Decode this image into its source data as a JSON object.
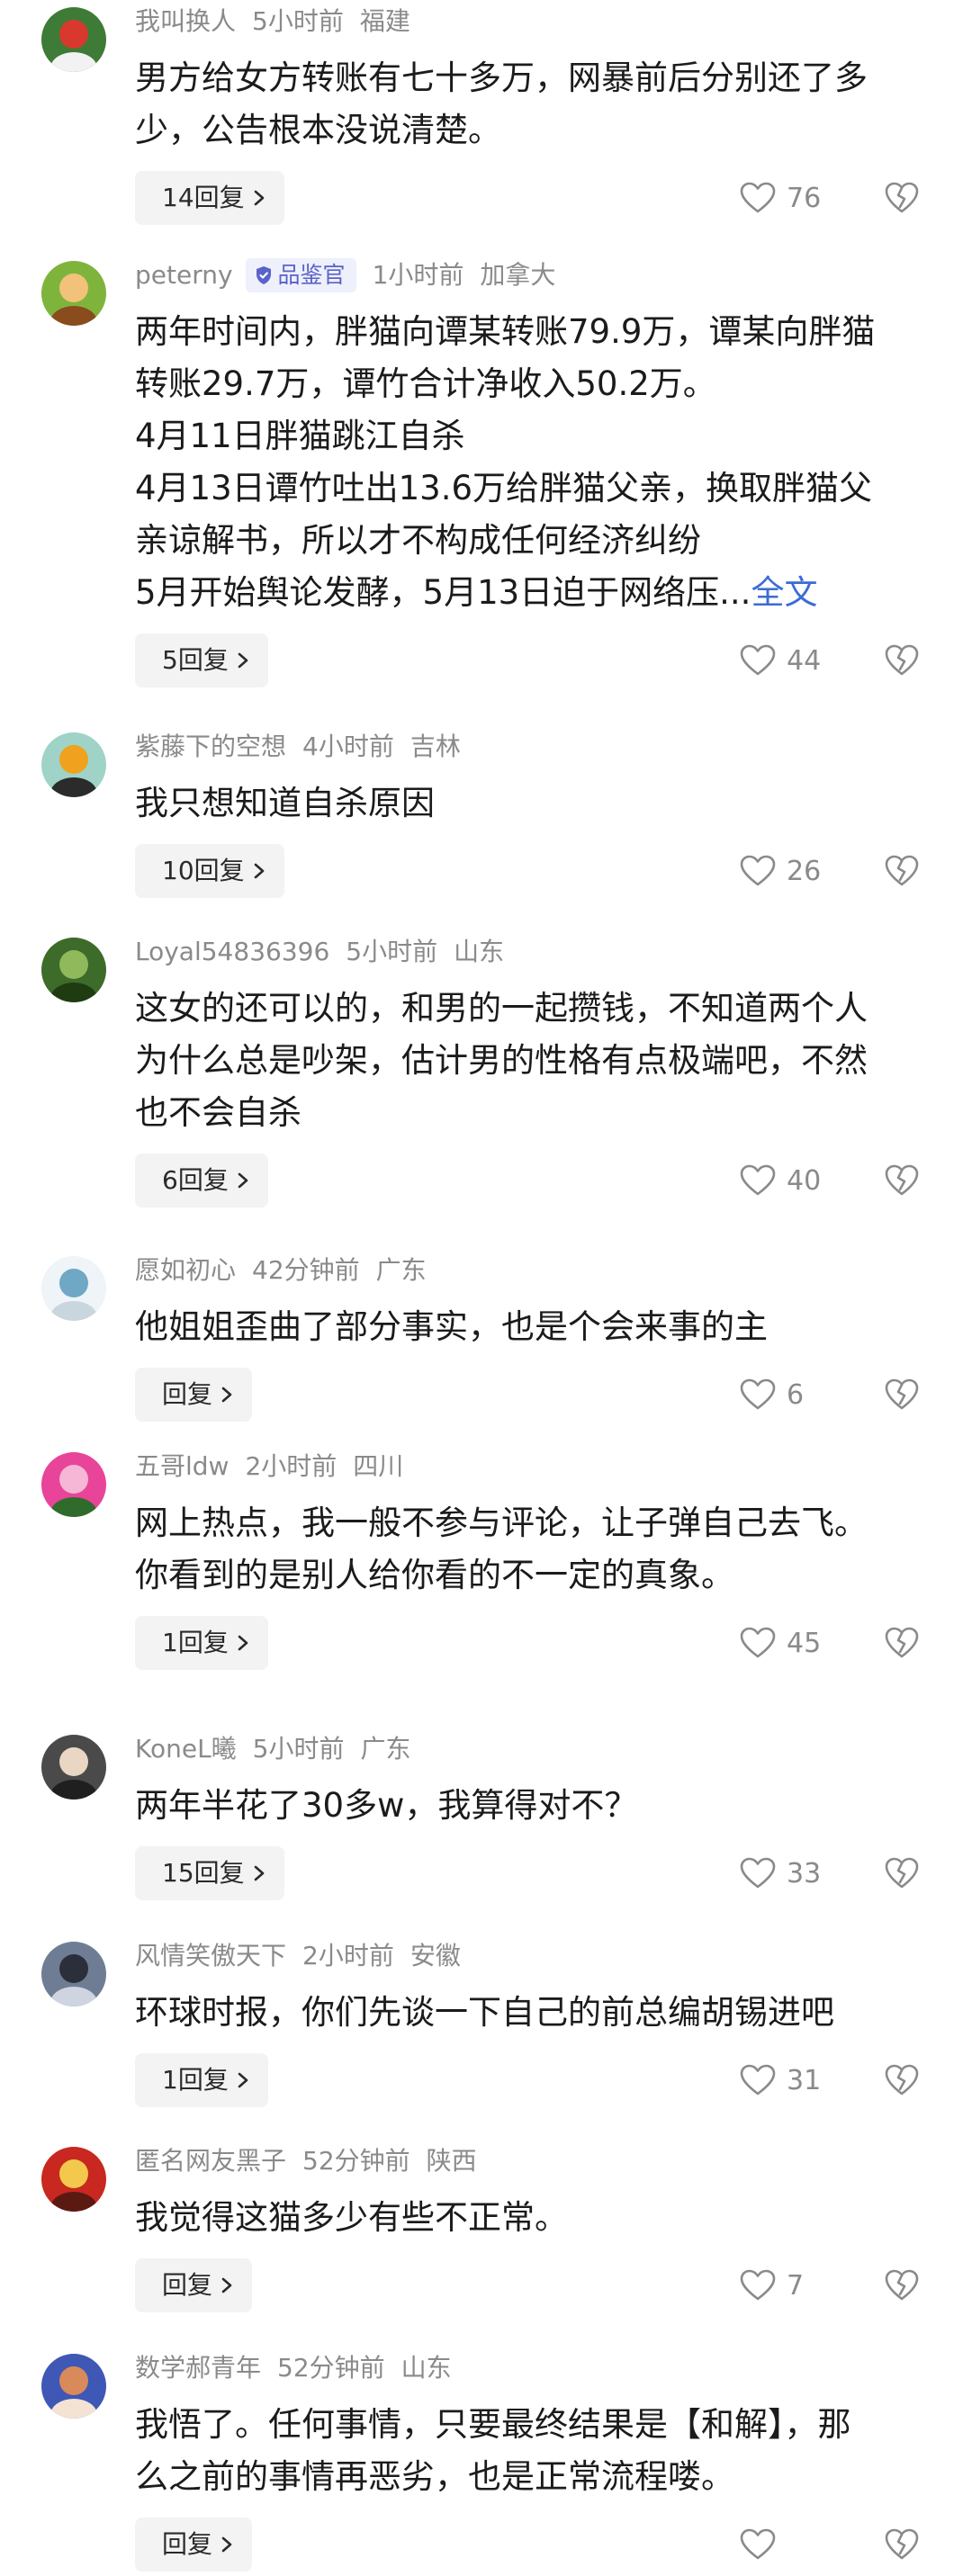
{
  "comments": [
    {
      "username": "我叫换人",
      "time": "5小时前",
      "location": "福建",
      "badge": "",
      "lines": [
        "男方给女方转账有七十多万，网暴前后分别还了多",
        "少，公告根本没说清楚。"
      ],
      "more": "",
      "reply": "14回复",
      "likes": "76",
      "avatar_colors": [
        "#3e7b36",
        "#d9382f",
        "#f2f2f2"
      ]
    },
    {
      "username": "peterny",
      "time": "1小时前",
      "location": "加拿大",
      "badge": "品鉴官",
      "lines": [
        "两年时间内，胖猫向谭某转账79.9万，谭某向胖猫",
        "转账29.7万，谭竹合计净收入50.2万。",
        "4月11日胖猫跳江自杀",
        "4月13日谭竹吐出13.6万给胖猫父亲，换取胖猫父",
        "亲谅解书，所以才不构成任何经济纠纷",
        "5月开始舆论发酵，5月13日迫于网络压..."
      ],
      "more": "全文",
      "reply": "5回复",
      "likes": "44",
      "avatar_colors": [
        "#7fb43c",
        "#f2c27b",
        "#8a4b1d"
      ]
    },
    {
      "username": "紫藤下的空想",
      "time": "4小时前",
      "location": "吉林",
      "badge": "",
      "lines": [
        "我只想知道自杀原因"
      ],
      "more": "",
      "reply": "10回复",
      "likes": "26",
      "avatar_colors": [
        "#9fd3c7",
        "#f0a11e",
        "#2b2b2b"
      ]
    },
    {
      "username": "Loyal54836396",
      "time": "5小时前",
      "location": "山东",
      "badge": "",
      "lines": [
        "这女的还可以的，和男的一起攒钱，不知道两个人",
        "为什么总是吵架，估计男的性格有点极端吧，不然",
        "也不会自杀"
      ],
      "more": "",
      "reply": "6回复",
      "likes": "40",
      "avatar_colors": [
        "#3d6b2a",
        "#8fb95a",
        "#1e3b12"
      ]
    },
    {
      "username": "愿如初心",
      "time": "42分钟前",
      "location": "广东",
      "badge": "",
      "lines": [
        "他姐姐歪曲了部分事实，也是个会来事的主"
      ],
      "more": "",
      "reply": "回复",
      "likes": "6",
      "avatar_colors": [
        "#eef4f7",
        "#6fa7c4",
        "#c9d6dd"
      ]
    },
    {
      "username": "五哥ldw",
      "time": "2小时前",
      "location": "四川",
      "badge": "",
      "lines": [
        "网上热点，我一般不参与评论，让子弹自己去飞。",
        "你看到的是别人给你看的不一定的真象。"
      ],
      "more": "",
      "reply": "1回复",
      "likes": "45",
      "avatar_colors": [
        "#e8449a",
        "#f6b7d6",
        "#2f6b2a"
      ]
    },
    {
      "username": "KoneL曦",
      "time": "5小时前",
      "location": "广东",
      "badge": "",
      "lines": [
        "两年半花了30多w，我算得对不？"
      ],
      "more": "",
      "reply": "15回复",
      "likes": "33",
      "avatar_colors": [
        "#4a4a4a",
        "#e9d7c4",
        "#1f1f1f"
      ]
    },
    {
      "username": "风情笑傲天下",
      "time": "2小时前",
      "location": "安徽",
      "badge": "",
      "lines": [
        "环球时报，你们先谈一下自己的前总编胡锡进吧"
      ],
      "more": "",
      "reply": "1回复",
      "likes": "31",
      "avatar_colors": [
        "#6f7d94",
        "#2a2f3a",
        "#cfd5e0"
      ]
    },
    {
      "username": "匿名网友黑子",
      "time": "52分钟前",
      "location": "陕西",
      "badge": "",
      "lines": [
        "我觉得这猫多少有些不正常。"
      ],
      "more": "",
      "reply": "回复",
      "likes": "7",
      "avatar_colors": [
        "#c8281f",
        "#f2c94c",
        "#5a1a12"
      ]
    },
    {
      "username": "数学郝青年",
      "time": "52分钟前",
      "location": "山东",
      "badge": "",
      "lines": [
        "我悟了。任何事情，只要最终结果是【和解】，那",
        "么之前的事情再恶劣，也是正常流程喽。"
      ],
      "more": "",
      "reply": "回复",
      "likes": "",
      "avatar_colors": [
        "#3f57b5",
        "#d98a5a",
        "#f4e3d3"
      ]
    }
  ]
}
